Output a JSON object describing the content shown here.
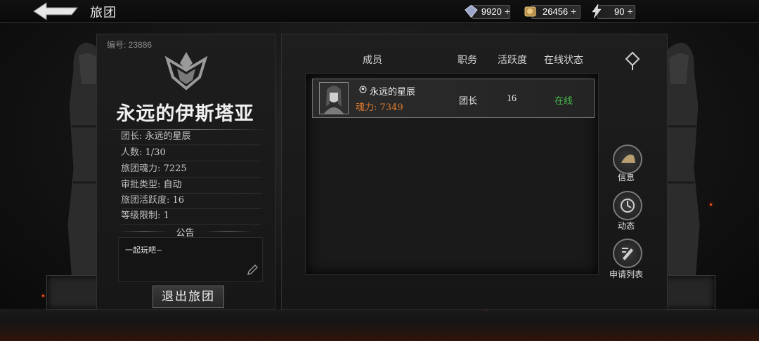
{
  "header": {
    "title": "旅团",
    "resources": [
      {
        "icon": "diamond-icon",
        "value": "9920",
        "plus": "+"
      },
      {
        "icon": "gold-icon",
        "value": "26456",
        "plus": "+"
      },
      {
        "icon": "energy-icon",
        "value": "90",
        "plus": "+"
      }
    ]
  },
  "guild": {
    "id_label": "编号: 23886",
    "name": "永远的伊斯塔亚",
    "info": [
      {
        "key": "团长:",
        "value": "永远的星辰"
      },
      {
        "key": "人数:",
        "value": "1/30"
      },
      {
        "key": "旅团魂力:",
        "value": "7225"
      },
      {
        "key": "审批类型:",
        "value": "自动"
      },
      {
        "key": "旅团活跃度:",
        "value": "16"
      },
      {
        "key": "等级限制:",
        "value": "1"
      }
    ],
    "notice_title": "公告",
    "notice_text": "一起玩吧~",
    "leave_label": "退出旅团"
  },
  "members": {
    "columns": [
      "成员",
      "职务",
      "活跃度",
      "在线状态"
    ],
    "rows": [
      {
        "name": "永远的星辰",
        "power_label": "魂力: 7349",
        "role": "团长",
        "activity": "16",
        "status": "在线",
        "status_color": "#46b84a"
      }
    ]
  },
  "side_menu": [
    {
      "icon": "info-icon",
      "label": "信息"
    },
    {
      "icon": "news-icon",
      "label": "动态"
    },
    {
      "icon": "apply-list-icon",
      "label": "申请列表"
    }
  ],
  "colors": {
    "power": "#e07a2e",
    "online": "#46b84a"
  }
}
